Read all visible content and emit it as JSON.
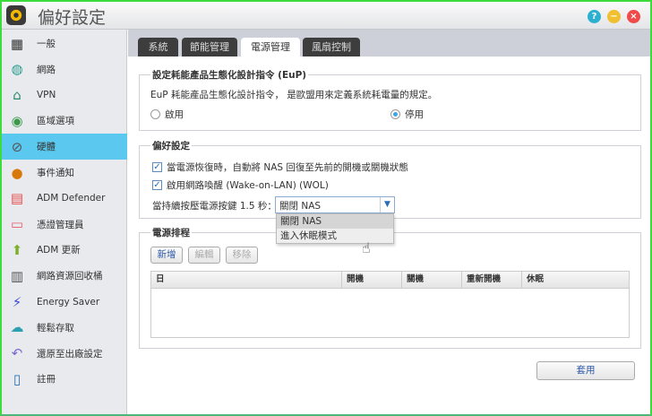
{
  "window": {
    "title": "偏好設定",
    "help_icon": "?",
    "min_icon": "−",
    "close_icon": "×"
  },
  "sidebar": {
    "items": [
      {
        "label": "一般",
        "icon": "nas-icon"
      },
      {
        "label": "網路",
        "icon": "globe-icon"
      },
      {
        "label": "VPN",
        "icon": "house-network-icon"
      },
      {
        "label": "區域選項",
        "icon": "region-icon"
      },
      {
        "label": "硬體",
        "icon": "hardware-icon",
        "selected": true
      },
      {
        "label": "事件通知",
        "icon": "alert-icon"
      },
      {
        "label": "ADM Defender",
        "icon": "firewall-icon"
      },
      {
        "label": "憑證管理員",
        "icon": "certificate-icon"
      },
      {
        "label": "ADM 更新",
        "icon": "update-arrow-icon"
      },
      {
        "label": "網路資源回收桶",
        "icon": "trash-icon"
      },
      {
        "label": "Energy Saver",
        "icon": "lightning-icon"
      },
      {
        "label": "輕鬆存取",
        "icon": "cloud-upload-icon"
      },
      {
        "label": "還原至出廠設定",
        "icon": "undo-icon"
      },
      {
        "label": "註冊",
        "icon": "register-icon"
      }
    ]
  },
  "tabs": [
    "系統",
    "節能管理",
    "電源管理",
    "風扇控制"
  ],
  "active_tab": "電源管理",
  "eup": {
    "legend": "設定耗能產品生態化設計指令 (EuP)",
    "description": "EuP 耗能產品生態化設計指令， 是歐盟用來定義系統耗電量的規定。",
    "enable_label": "啟用",
    "disable_label": "停用",
    "selected": "停用"
  },
  "prefs": {
    "legend": "偏好設定",
    "restore_label": "當電源恢復時，自動將 NAS 回復至先前的開機或關機狀態",
    "wol_label": "啟用網路喚醒 (Wake-on-LAN) (WOL)",
    "button_label": "當持續按壓電源按鍵 1.5 秒：",
    "select_value": "關閉 NAS",
    "options": [
      "關閉 NAS",
      "進入休眠模式"
    ]
  },
  "schedule": {
    "legend": "電源排程",
    "add": "新增",
    "edit": "編輯",
    "remove": "移除",
    "columns": [
      "日",
      "開機",
      "關機",
      "重新開機",
      "休眠"
    ]
  },
  "apply": "套用",
  "colors": {
    "selected": "#5bc8ef",
    "accent": "#2a6db5"
  }
}
